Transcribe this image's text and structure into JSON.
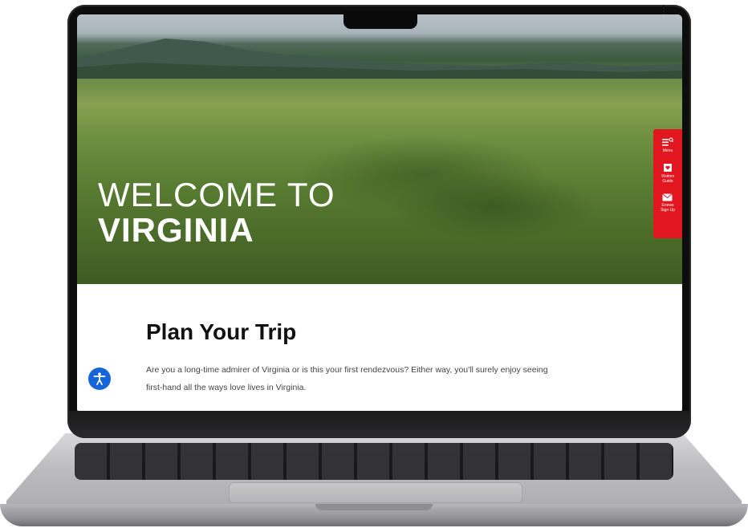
{
  "hero": {
    "title_line1": "WELCOME TO",
    "title_line2": "VIRGINIA"
  },
  "side_menu": {
    "items": [
      {
        "label": "Menu",
        "icon": "menu-search-icon"
      },
      {
        "label": "Visitors\nGuide",
        "icon": "heart-book-icon"
      },
      {
        "label": "Enews\nSign Up",
        "icon": "envelope-icon"
      }
    ]
  },
  "plan": {
    "title": "Plan Your Trip",
    "text_line1": "Are you a long-time admirer of Virginia or is this your first rendezvous? Either way, you'll surely enjoy seeing",
    "text_line2": "first-hand all the ways love lives in Virginia."
  },
  "accessibility": {
    "icon": "accessibility-icon"
  },
  "colors": {
    "accent_red": "#e1161f",
    "accessibility_blue": "#1466d6",
    "heading": "#111111",
    "body_text": "#444444"
  }
}
